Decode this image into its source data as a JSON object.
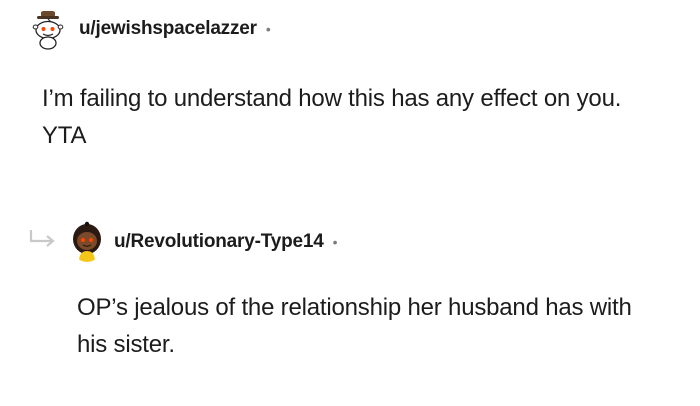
{
  "comments": [
    {
      "username": "u/jewishspacelazzer",
      "separator": "•",
      "body": "I’m failing to understand how this has any effect on you. YTA",
      "avatar_icon": "snoo-avatar-icon"
    },
    {
      "username": "u/Revolutionary-Type14",
      "separator": "•",
      "body": "OP’s jealous of the relationship her husband has with his sister.",
      "avatar_icon": "snoo-avatar-icon",
      "reply_icon": "reply-arrow-icon"
    }
  ],
  "colors": {
    "text": "#1c1c1c",
    "muted": "#7c7c7c",
    "reply_arrow": "#c9c9c9"
  }
}
